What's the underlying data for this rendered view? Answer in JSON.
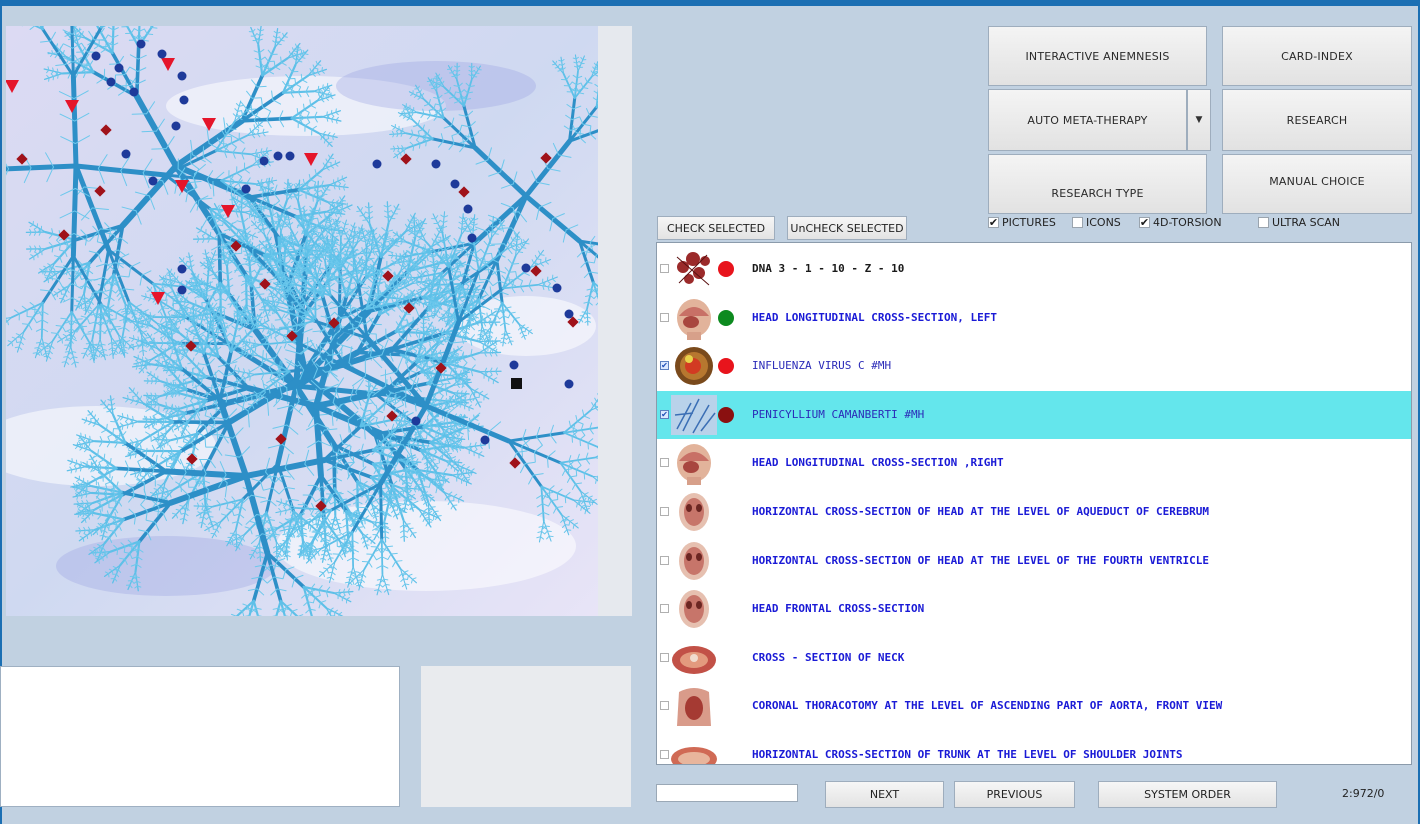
{
  "menu": {
    "interactive_anemnesis": "INTERACTIVE ANEMNESIS",
    "card_index": "CARD-INDEX",
    "auto_meta_therapy": "AUTO META-THERAPY",
    "research": "RESEARCH",
    "research_type": "RESEARCH TYPE",
    "manual_choice": "MANUAL CHOICE"
  },
  "selection": {
    "check_selected": "CHECK SELECTED",
    "uncheck_selected": "UnCHECK SELECTED"
  },
  "options": [
    {
      "label": "PICTURES",
      "checked": true
    },
    {
      "label": "ICONS",
      "checked": false
    },
    {
      "label": "4D-TORSION",
      "checked": true
    },
    {
      "label": "ULTRA SCAN",
      "checked": false
    }
  ],
  "list": {
    "items": [
      {
        "label": "DNA 3 - 1 - 10 - Z - 10",
        "checked": false,
        "dot": "#e8141c",
        "text_color": "#1a1a1a",
        "bold": true,
        "selected": false,
        "thumb": "dna"
      },
      {
        "label": "HEAD LONGITUDINAL CROSS-SECTION, LEFT",
        "checked": false,
        "dot": "#0d8a1f",
        "text_color": "#1a1ad6",
        "bold": true,
        "selected": false,
        "thumb": "head"
      },
      {
        "label": "INFLUENZA VIRUS C #MH",
        "checked": true,
        "dot": "#e8141c",
        "text_color": "#2b2bb8",
        "bold": false,
        "selected": false,
        "thumb": "virus"
      },
      {
        "label": "PENICYLLIUM CAMANBERTI #MH",
        "checked": true,
        "dot": "#8a1010",
        "text_color": "#2b2bb8",
        "bold": false,
        "selected": true,
        "thumb": "fungus"
      },
      {
        "label": "HEAD LONGITUDINAL CROSS-SECTION ,RIGHT",
        "checked": false,
        "dot": "",
        "text_color": "#1a1ad6",
        "bold": true,
        "selected": false,
        "thumb": "head"
      },
      {
        "label": "HORIZONTAL CROSS-SECTION OF HEAD AT THE LEVEL OF AQUEDUCT OF CEREBRUM",
        "checked": false,
        "dot": "",
        "text_color": "#1a1ad6",
        "bold": true,
        "selected": false,
        "thumb": "skull"
      },
      {
        "label": "HORIZONTAL CROSS-SECTION OF HEAD AT THE LEVEL OF THE FOURTH VENTRICLE",
        "checked": false,
        "dot": "",
        "text_color": "#1a1ad6",
        "bold": true,
        "selected": false,
        "thumb": "skull"
      },
      {
        "label": "HEAD FRONTAL CROSS-SECTION",
        "checked": false,
        "dot": "",
        "text_color": "#1a1ad6",
        "bold": true,
        "selected": false,
        "thumb": "skull"
      },
      {
        "label": "CROSS - SECTION  OF  NECK",
        "checked": false,
        "dot": "",
        "text_color": "#1a1ad6",
        "bold": true,
        "selected": false,
        "thumb": "neck"
      },
      {
        "label": "CORONAL THORACOTOMY AT THE LEVEL OF ASCENDING PART OF AORTA, FRONT VIEW",
        "checked": false,
        "dot": "",
        "text_color": "#1a1ad6",
        "bold": true,
        "selected": false,
        "thumb": "torso"
      },
      {
        "label": "HORIZONTAL CROSS-SECTION OF TRUNK AT THE LEVEL OF SHOULDER JOINTS",
        "checked": false,
        "dot": "",
        "text_color": "#1a1ad6",
        "bold": true,
        "selected": false,
        "thumb": "trunk"
      }
    ]
  },
  "nav": {
    "next": "NEXT",
    "previous": "PREVIOUS",
    "system_order": "SYSTEM ORDER",
    "counter": "2:972/0",
    "search_value": ""
  },
  "icons": {
    "dropdown": "chevron-down-icon",
    "checkmark": "checkmark-icon"
  }
}
